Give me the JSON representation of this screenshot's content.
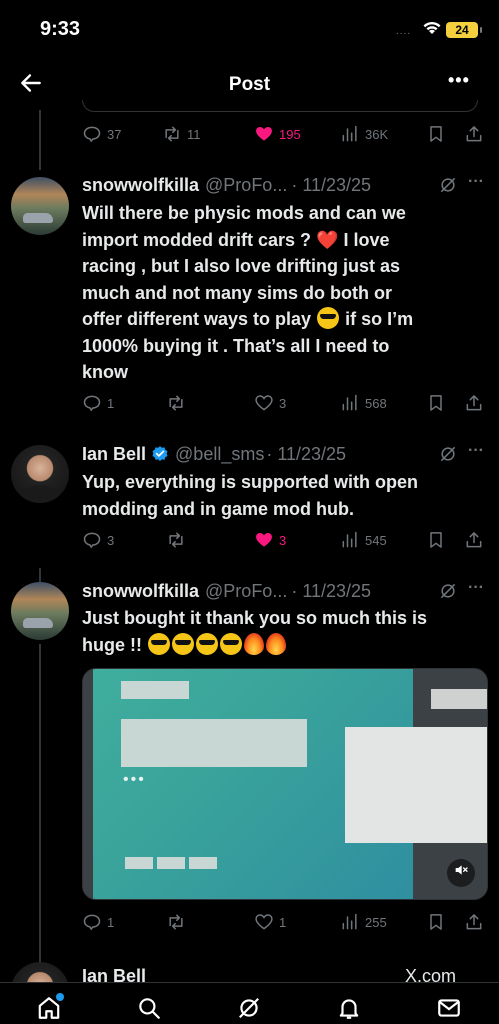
{
  "status_bar": {
    "time": "9:33",
    "signal": "....",
    "battery": "24"
  },
  "header": {
    "title": "Post",
    "more": "•••"
  },
  "prev_actions": {
    "replies": "37",
    "reposts": "11",
    "likes": "195",
    "views": "36K"
  },
  "tweets": [
    {
      "name": "snowwolfkilla",
      "handle": "@ProFo...",
      "date": "· 11/23/25",
      "lines": [
        "Will there be physic mods and can we",
        "import modded drift cars ?",
        "I love",
        "racing , but I also love drifting just as",
        "much and not many sims do both or",
        "offer different ways to play",
        "if so I’m",
        "1000% buying it . That’s all I need to",
        "know"
      ],
      "replies": "1",
      "reposts": "",
      "likes": "3",
      "views": "568"
    },
    {
      "name": "Ian Bell",
      "handle": "@bell_sms",
      "date": "· 11/23/25",
      "lines": [
        "Yup, everything is supported with open",
        "modding and in game mod hub."
      ],
      "replies": "3",
      "reposts": "",
      "likes": "3",
      "views": "545"
    },
    {
      "name": "snowwolfkilla",
      "handle": "@ProFo...",
      "date": "· 11/23/25",
      "lines": [
        "Just bought it thank you so much this is",
        "huge !!"
      ],
      "replies": "1",
      "reposts": "",
      "likes": "1",
      "views": "255"
    }
  ],
  "partial": {
    "name": "Ian Bell",
    "right": "X.com"
  },
  "colors": {
    "like": "#f91880",
    "muted": "#71767b",
    "verified": "#1d9bf0"
  },
  "icons": [
    "back-arrow-icon",
    "reply-icon",
    "repost-icon",
    "heart-icon",
    "views-icon",
    "bookmark-icon",
    "share-icon",
    "grok-icon",
    "home-icon",
    "search-icon",
    "bell-icon",
    "mail-icon"
  ]
}
